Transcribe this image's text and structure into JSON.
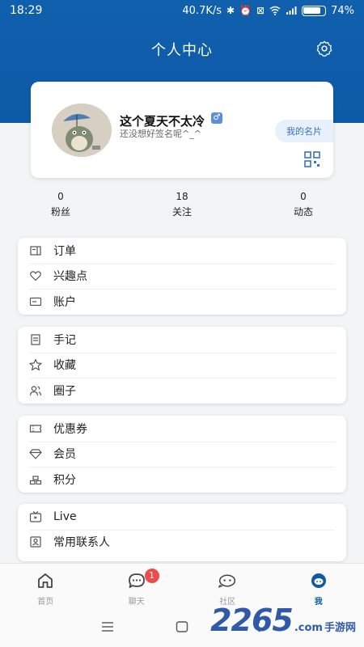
{
  "status_bar": {
    "time": "18:29",
    "network_speed": "40.7K/s",
    "battery": "74%"
  },
  "header": {
    "title": "个人中心"
  },
  "profile": {
    "nickname": "这个夏天不太冷",
    "gender_symbol": "♂",
    "signature": "还没想好签名呢^_^",
    "my_card_label": "我的名片"
  },
  "stats": [
    {
      "value": "0",
      "label": "粉丝"
    },
    {
      "value": "18",
      "label": "关注"
    },
    {
      "value": "0",
      "label": "动态"
    }
  ],
  "menu_groups": [
    {
      "items": [
        {
          "label": "订单",
          "icon": "order-icon"
        },
        {
          "label": "兴趣点",
          "icon": "heart-icon"
        },
        {
          "label": "账户",
          "icon": "card-icon"
        }
      ]
    },
    {
      "items": [
        {
          "label": "手记",
          "icon": "note-icon"
        },
        {
          "label": "收藏",
          "icon": "star-icon"
        },
        {
          "label": "圈子",
          "icon": "group-icon"
        }
      ]
    },
    {
      "items": [
        {
          "label": "优惠券",
          "icon": "coupon-icon"
        },
        {
          "label": "会员",
          "icon": "diamond-icon"
        },
        {
          "label": "积分",
          "icon": "points-icon"
        }
      ]
    },
    {
      "items": [
        {
          "label": "Live",
          "icon": "tv-icon"
        },
        {
          "label": "常用联系人",
          "icon": "contact-icon"
        }
      ]
    }
  ],
  "tabbar": {
    "tabs": [
      {
        "label": "首页",
        "icon": "home-icon"
      },
      {
        "label": "聊天",
        "icon": "chat-icon",
        "badge": "1"
      },
      {
        "label": "社区",
        "icon": "community-icon"
      },
      {
        "label": "我",
        "icon": "profile-icon"
      }
    ]
  },
  "watermark": {
    "number": "2265",
    "suffix": ".com",
    "site": "手游网"
  },
  "colors": {
    "header": "#0d5aa6",
    "accent": "#3a72c2",
    "badge": "#f04b4b"
  }
}
